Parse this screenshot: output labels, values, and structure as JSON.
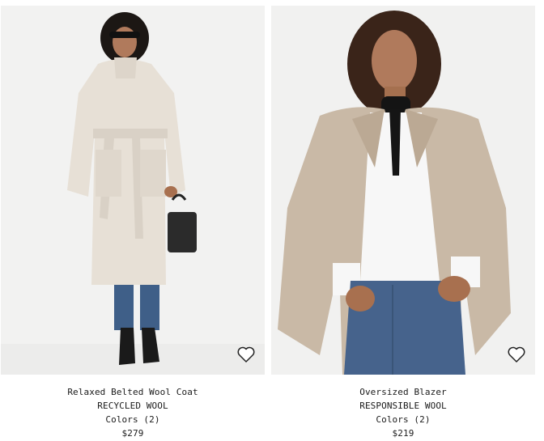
{
  "products": [
    {
      "name": "Relaxed Belted Wool Coat",
      "material": "RECYCLED WOOL",
      "colors": "Colors (2)",
      "price": "$279",
      "favorite_icon": "heart-outline-icon"
    },
    {
      "name": "Oversized Blazer",
      "material": "RESPONSIBLE WOOL",
      "colors": "Colors (2)",
      "price": "$219",
      "favorite_icon": "heart-outline-icon"
    }
  ],
  "colors": {
    "background": "#ffffff",
    "photo_bg": "#f2f2f1",
    "coat": "#e7e0d6",
    "blazer": "#c9b9a6",
    "jeans": "#46638c",
    "text": "#1a1a1a"
  }
}
